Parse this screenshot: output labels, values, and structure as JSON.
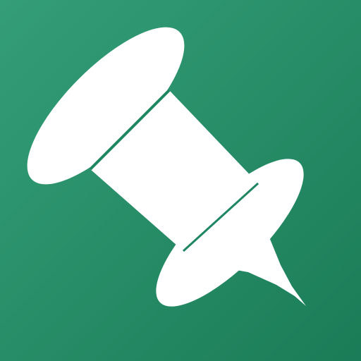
{
  "icon": {
    "name": "pushpin-icon",
    "background_gradient": [
      "#349e78",
      "#1a7c57"
    ],
    "foreground": "#ffffff"
  }
}
